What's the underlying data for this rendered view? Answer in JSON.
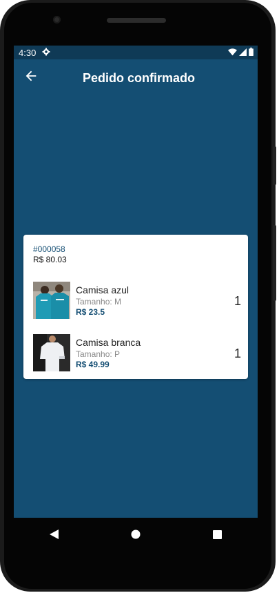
{
  "status_bar": {
    "time": "4:30"
  },
  "app_bar": {
    "title": "Pedido confirmado"
  },
  "order": {
    "id": "#000058",
    "total": "R$ 80.03",
    "items": [
      {
        "name": "Camisa azul",
        "size": "Tamanho: M",
        "price": "R$ 23.5",
        "qty": "1",
        "thumb_icon": "blue-shirt-photo"
      },
      {
        "name": "Camisa branca",
        "size": "Tamanho: P",
        "price": "R$ 49.99",
        "qty": "1",
        "thumb_icon": "white-shirt-photo"
      }
    ]
  },
  "colors": {
    "primary": "#144e73",
    "status_bar": "#0f3a56",
    "card": "#ffffff"
  },
  "nav_bar": {
    "back": "back-triangle-icon",
    "home": "home-circle-icon",
    "recents": "recents-square-icon"
  }
}
